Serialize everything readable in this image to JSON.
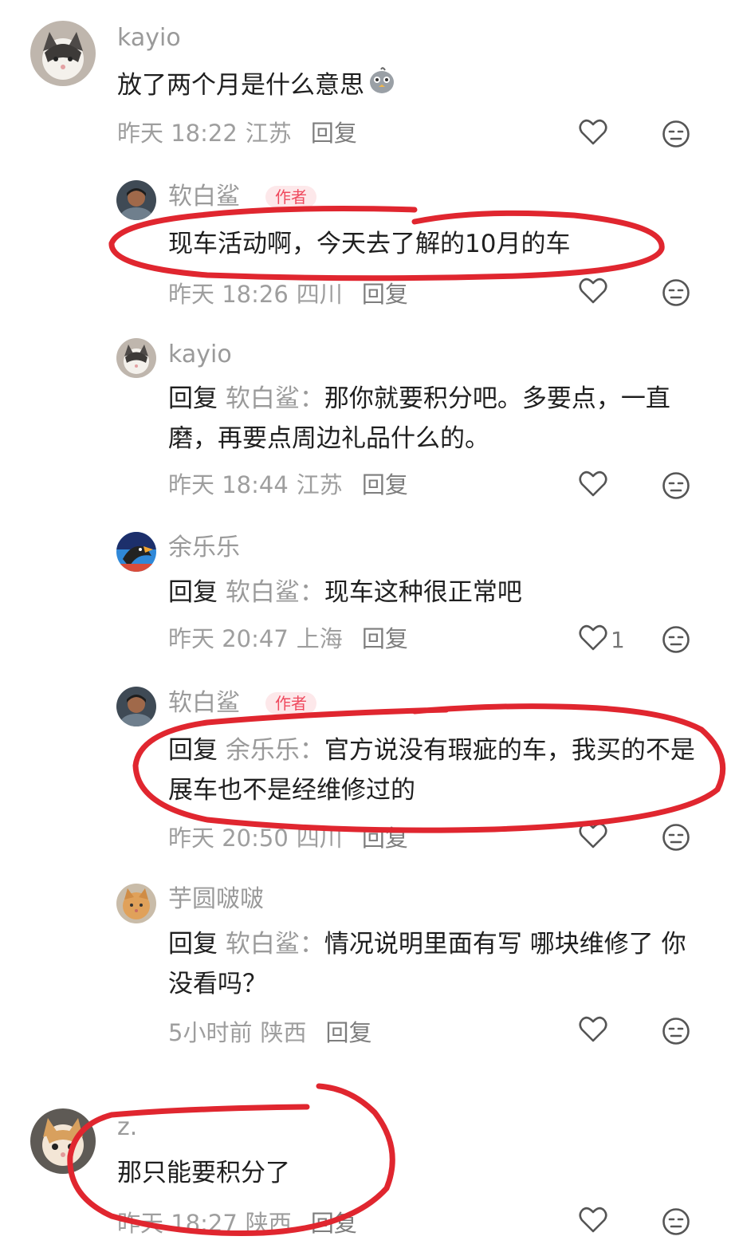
{
  "comments": [
    {
      "user": "kayio",
      "badge": "",
      "text": "放了两个月是什么意思",
      "reply_prefix": "",
      "reply_to": "",
      "time": "昨天 18:22",
      "location": "江苏",
      "reply_label": "回复",
      "likes": "",
      "avatar_icon": "cat-avatar-icon"
    },
    {
      "user": "软白鲨",
      "badge": "作者",
      "text": "现车活动啊，今天去了解的10月的车",
      "reply_prefix": "",
      "reply_to": "",
      "time": "昨天 18:26",
      "location": "四川",
      "reply_label": "回复",
      "likes": "",
      "avatar_icon": "person-avatar-icon"
    },
    {
      "user": "kayio",
      "badge": "",
      "text": "那你就要积分吧。多要点，一直磨，再要点周边礼品什么的。",
      "reply_prefix": "回复",
      "reply_to": "软白鲨：",
      "time": "昨天 18:44",
      "location": "江苏",
      "reply_label": "回复",
      "likes": "",
      "avatar_icon": "cat-avatar-icon"
    },
    {
      "user": "余乐乐",
      "badge": "",
      "text": "现车这种很正常吧",
      "reply_prefix": "回复",
      "reply_to": "软白鲨：",
      "time": "昨天 20:47",
      "location": "上海",
      "reply_label": "回复",
      "likes": "1",
      "avatar_icon": "bird-avatar-icon"
    },
    {
      "user": "软白鲨",
      "badge": "作者",
      "text": "官方说没有瑕疵的车，我买的不是展车也不是经维修过的",
      "reply_prefix": "回复",
      "reply_to": "余乐乐：",
      "time": "昨天 20:50",
      "location": "四川",
      "reply_label": "回复",
      "likes": "",
      "avatar_icon": "person-avatar-icon"
    },
    {
      "user": "芋圆啵啵",
      "badge": "",
      "text": "情况说明里面有写 哪块维修了 你没看吗？",
      "reply_prefix": "回复",
      "reply_to": "软白鲨：",
      "time": "5小时前",
      "location": "陕西",
      "reply_label": "回复",
      "likes": "",
      "avatar_icon": "orange-cat-avatar-icon"
    },
    {
      "user": "z.",
      "badge": "",
      "text": "那只能要积分了",
      "reply_prefix": "",
      "reply_to": "",
      "time": "昨天 18:27",
      "location": "陕西",
      "reply_label": "回复",
      "likes": "",
      "avatar_icon": "kitten-avatar-icon"
    }
  ],
  "colors": {
    "annotation": "#e0262f",
    "author_badge": "#ef4a5e",
    "muted": "#9e9e9e"
  }
}
